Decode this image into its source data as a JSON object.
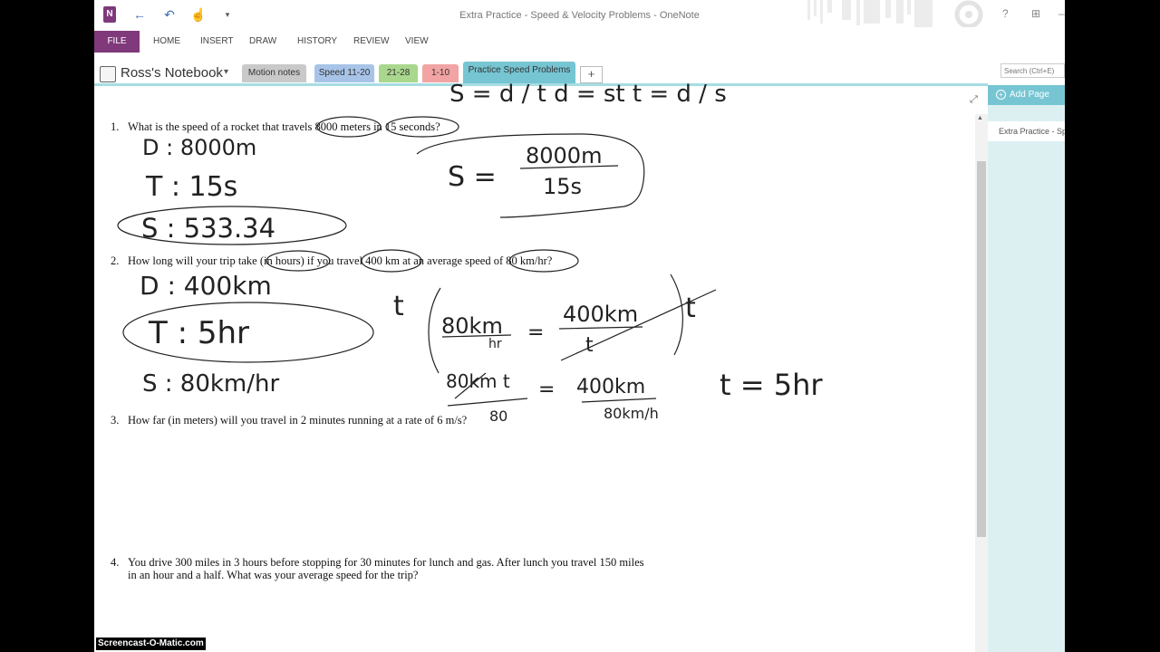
{
  "window": {
    "title": "Extra Practice - Speed & Velocity Problems - OneNote",
    "help": "?",
    "restore": "⊞",
    "minimize": "–"
  },
  "qat": {
    "app_icon": "N",
    "back_icon": "←",
    "undo_icon": "↶",
    "touch_icon": "☝",
    "customize_icon": "▾"
  },
  "ribbon": {
    "file": "FILE",
    "tabs": [
      "HOME",
      "INSERT",
      "DRAW",
      "HISTORY",
      "REVIEW",
      "VIEW"
    ]
  },
  "notebook": {
    "name": "Ross's Notebook",
    "caret": "▾",
    "sections": [
      {
        "label": "Motion notes",
        "color": "#c9c9c9"
      },
      {
        "label": "Speed 11-20",
        "color": "#a7c4e8"
      },
      {
        "label": "21-28",
        "color": "#a9d78e"
      },
      {
        "label": "1-10",
        "color": "#f2a3a3"
      },
      {
        "label": "Practice Speed Problems",
        "color": "#76c5d3"
      }
    ],
    "add_section": "+",
    "search_placeholder": "Search (Ctrl+E)"
  },
  "pages_pane": {
    "add_page": "Add Page",
    "add_icon": "+",
    "pages": [
      "Extra Practice - Speed & Velocity Problems"
    ]
  },
  "questions": [
    {
      "num": "1.",
      "text": "What is the speed of a rocket that travels 8000 meters in 15 seconds?"
    },
    {
      "num": "2.",
      "text": "How long will your trip take (in hours) if you travel 400 km at an average speed of 80 km/hr?"
    },
    {
      "num": "3.",
      "text": "How far (in meters) will you travel in 2 minutes running at a rate of 6 m/s?"
    },
    {
      "num": "4.",
      "text": "You drive 300 miles in 3 hours before stopping for 30 minutes for lunch and gas. After lunch you travel 150 miles in an hour and a half. What was your average speed for the trip?"
    }
  ],
  "handwriting": {
    "top_partial": "S = d / t     d = st     t = d / s",
    "q1_distance": "D : 8000m",
    "q1_time": "T : 15s",
    "q1_speed": "S : 533.34",
    "q1_formula_s": "S =",
    "q1_formula_num": "8000m",
    "q1_formula_den": "15s",
    "q2_distance": "D : 400km",
    "q2_time": "T : 5hr",
    "q2_speed": "S : 80km/hr",
    "q2_t": "t",
    "q2_eq1_left_num": "80km",
    "q2_eq1_left_den": "hr",
    "q2_eq1_equals": "=",
    "q2_eq1_right_num": "400km",
    "q2_eq1_right_den": "t",
    "q2_t_right": "t",
    "q2_eq2_left": "80km t",
    "q2_eq2_left_den": "80",
    "q2_eq2_equals": "=",
    "q2_eq2_right_num": "400km",
    "q2_eq2_right_den": "80km/h",
    "q2_answer": "t = 5hr"
  },
  "watermark": "Screencast-O-Matic.com"
}
